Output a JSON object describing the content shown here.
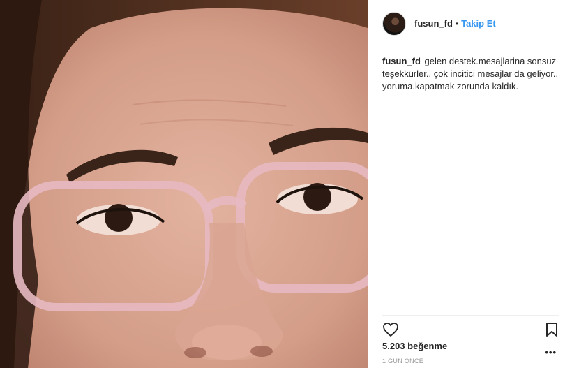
{
  "header": {
    "username": "fusun_fd",
    "separator": "•",
    "follow_label": "Takip Et"
  },
  "caption": {
    "username": "fusun_fd",
    "text": "gelen destek.mesajlarina sonsuz teşekkürler.. çok incitici mesajlar da geliyor.. yoruma.kapatmak zorunda kaldık."
  },
  "actions": {
    "like_icon": "heart-outline-icon",
    "save_icon": "bookmark-icon",
    "more_label": "•••"
  },
  "likes_text": "5.203 beğenme",
  "timestamp": "1 GÜN ÖNCE",
  "colors": {
    "accent": "#3897f0",
    "text": "#262626",
    "muted": "#999999",
    "border": "#efefef"
  }
}
